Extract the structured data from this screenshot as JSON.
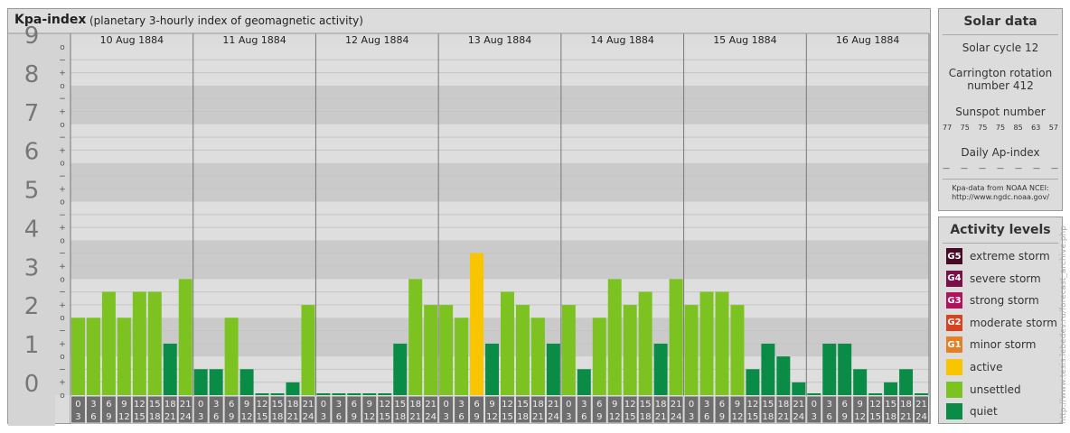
{
  "header": {
    "title": "Kpa-index",
    "subtitle": "(planetary 3-hourly index of geomagnetic activity)"
  },
  "chart_data": {
    "type": "bar",
    "ylim": [
      0,
      9
    ],
    "y_major_labels": [
      "0",
      "1",
      "2",
      "3",
      "4",
      "5",
      "6",
      "7",
      "8",
      "9"
    ],
    "y_minor_labels": [
      "o",
      "+",
      "−"
    ],
    "days": [
      "10 Aug 1884",
      "11 Aug 1884",
      "12 Aug 1884",
      "13 Aug 1884",
      "14 Aug 1884",
      "15 Aug 1884",
      "16 Aug 1884"
    ],
    "interval_start": [
      "0",
      "3",
      "6",
      "9",
      "12",
      "15",
      "18",
      "21"
    ],
    "interval_end": [
      "3",
      "6",
      "9",
      "12",
      "15",
      "18",
      "21",
      "24"
    ],
    "values": [
      2.0,
      2.0,
      2.67,
      2.0,
      2.67,
      2.67,
      1.33,
      3.0,
      0.67,
      0.67,
      2.0,
      0.67,
      0.0,
      0.0,
      0.33,
      2.33,
      0.0,
      0.0,
      0.0,
      0.0,
      0.0,
      1.33,
      3.0,
      2.33,
      2.33,
      2.0,
      3.67,
      1.33,
      2.67,
      2.33,
      2.0,
      1.33,
      2.33,
      0.67,
      2.0,
      3.0,
      2.33,
      2.67,
      1.33,
      3.0,
      2.33,
      2.67,
      2.67,
      2.33,
      0.67,
      1.33,
      1.0,
      0.33,
      0.0,
      1.33,
      1.33,
      0.67,
      0.0,
      0.33,
      0.67,
      0.0
    ],
    "colors": {
      "quiet": "#0b8c46",
      "unsettled": "#7cc321",
      "active": "#f9c400",
      "bg_band_dark": "#cacaca",
      "bg_band_light": "#dedede",
      "axis_label": "#777777",
      "interval_box": "#6e6e6e"
    }
  },
  "solar": {
    "title": "Solar data",
    "cycle": "Solar cycle 12",
    "carrington_line1": "Carrington rotation",
    "carrington_line2": "number 412",
    "sunspot_title": "Sunspot number",
    "sunspots": [
      "77",
      "75",
      "75",
      "75",
      "85",
      "63",
      "57"
    ],
    "ap_title": "Daily Ap-index",
    "ap_values": [
      "—",
      "—",
      "—",
      "—",
      "—",
      "—",
      "—"
    ],
    "source_line1": "Kpa-data from NOAA NCEI:",
    "source_line2": "http://www.ngdc.noaa.gov/"
  },
  "levels": {
    "title": "Activity levels",
    "items": [
      {
        "code": "G5",
        "label": "extreme storm",
        "color": "#4a0a26"
      },
      {
        "code": "G4",
        "label": "severe storm",
        "color": "#7a0f4a"
      },
      {
        "code": "G3",
        "label": "strong storm",
        "color": "#b0125e"
      },
      {
        "code": "G2",
        "label": "moderate storm",
        "color": "#d9411f"
      },
      {
        "code": "G1",
        "label": "minor storm",
        "color": "#e67e22"
      },
      {
        "code": "",
        "label": "active",
        "color": "#f9c400"
      },
      {
        "code": "",
        "label": "unsettled",
        "color": "#7cc321"
      },
      {
        "code": "",
        "label": "quiet",
        "color": "#0b8c46"
      }
    ]
  },
  "watermark": "http://www.tesis.lebedev.ru/forecast_archive.php"
}
